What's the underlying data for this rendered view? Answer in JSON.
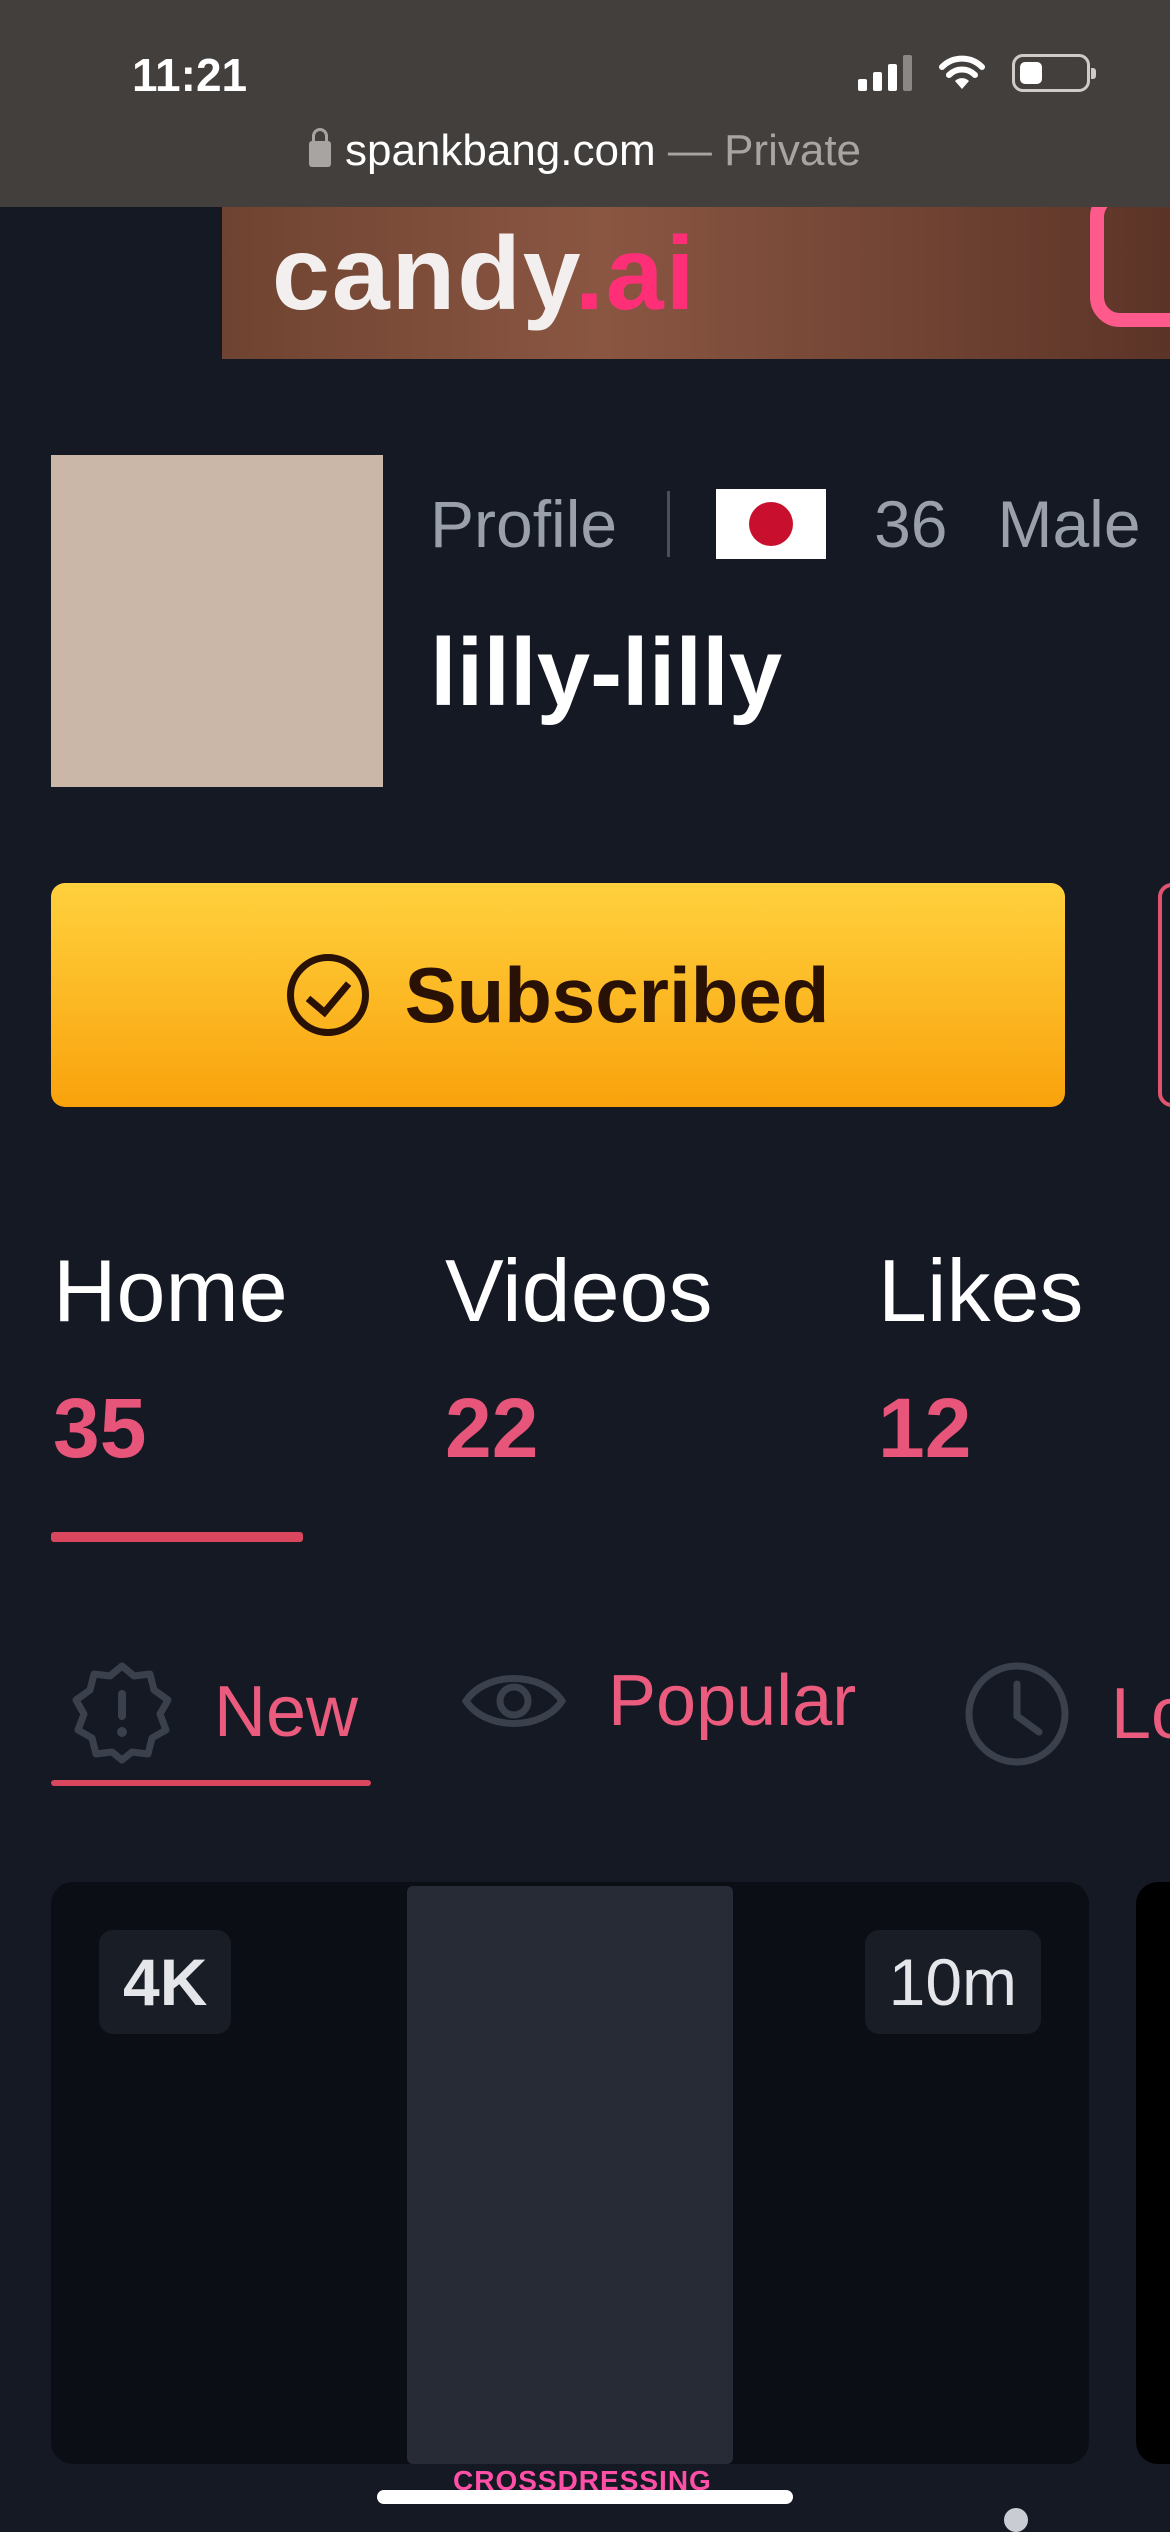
{
  "status_bar": {
    "time": "11:21",
    "battery_level": 0.35
  },
  "url_bar": {
    "domain": "spankbang.com",
    "separator": " — ",
    "mode": "Private"
  },
  "ad_banner": {
    "brand_main": "candy",
    "brand_suffix": ".ai"
  },
  "profile": {
    "type_label": "Profile",
    "country_flag": "Japan",
    "age": "36",
    "gender": "Male",
    "username": "lilly-lilly"
  },
  "subscribe_button": {
    "label": "Subscribed",
    "icon": "check-circle-icon",
    "color": "#f9a20c"
  },
  "tabs": [
    {
      "label": "Home",
      "count": "35",
      "active": true
    },
    {
      "label": "Videos",
      "count": "22",
      "active": false
    },
    {
      "label": "Likes",
      "count": "12",
      "active": false
    }
  ],
  "sort_tabs": [
    {
      "label": "New",
      "icon": "new-badge-icon",
      "active": true
    },
    {
      "label": "Popular",
      "icon": "eye-icon",
      "active": false
    },
    {
      "label": "Lo",
      "icon": "clock-icon",
      "active": false
    }
  ],
  "video_card": {
    "quality_badge": "4K",
    "duration": "10m",
    "caption": "CROSSDRESSING"
  },
  "accent_color": "#e8557a"
}
